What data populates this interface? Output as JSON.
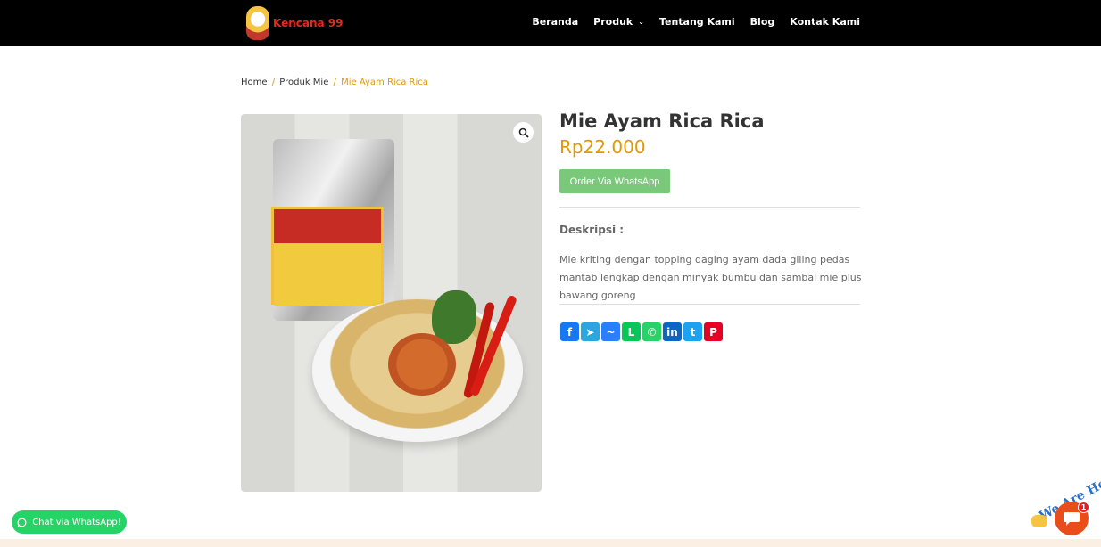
{
  "header": {
    "logo_text": "Kencana 99",
    "nav": [
      {
        "label": "Beranda"
      },
      {
        "label": "Produk",
        "has_dropdown": true
      },
      {
        "label": "Tentang Kami"
      },
      {
        "label": "Blog"
      },
      {
        "label": "Kontak Kami"
      }
    ]
  },
  "breadcrumb": {
    "home": "Home",
    "sep": "/",
    "category": "Produk Mie",
    "current": "Mie Ayam Rica Rica"
  },
  "product": {
    "title": "Mie Ayam Rica Rica",
    "price": "Rp22.000",
    "order_button": "Order Via WhatsApp",
    "description_heading": "Deskripsi :",
    "description": "Mie kriting dengan topping daging ayam dada giling pedas mantab lengkap dengan minyak bumbu dan sambal mie plus bawang goreng",
    "zoom_icon": "search-icon"
  },
  "share": [
    {
      "name": "facebook-icon",
      "glyph": "f",
      "color": "#1877f2"
    },
    {
      "name": "telegram-icon",
      "glyph": "➤",
      "color": "#2ca5e0"
    },
    {
      "name": "messenger-icon",
      "glyph": "~",
      "color": "#2a7fff"
    },
    {
      "name": "line-icon",
      "glyph": "L",
      "color": "#06c755"
    },
    {
      "name": "whatsapp-icon",
      "glyph": "✆",
      "color": "#25d366"
    },
    {
      "name": "linkedin-icon",
      "glyph": "in",
      "color": "#0a66c2"
    },
    {
      "name": "twitter-icon",
      "glyph": "t",
      "color": "#1da1f2"
    },
    {
      "name": "pinterest-icon",
      "glyph": "P",
      "color": "#e60023"
    }
  ],
  "floating": {
    "whatsapp_label": "Chat via WhatsApp!",
    "chat_badge_count": "1",
    "chat_tag": "We Are Here!"
  },
  "colors": {
    "accent": "#e09900",
    "whatsapp_button": "#7ac97a",
    "header_bg": "#000000"
  }
}
